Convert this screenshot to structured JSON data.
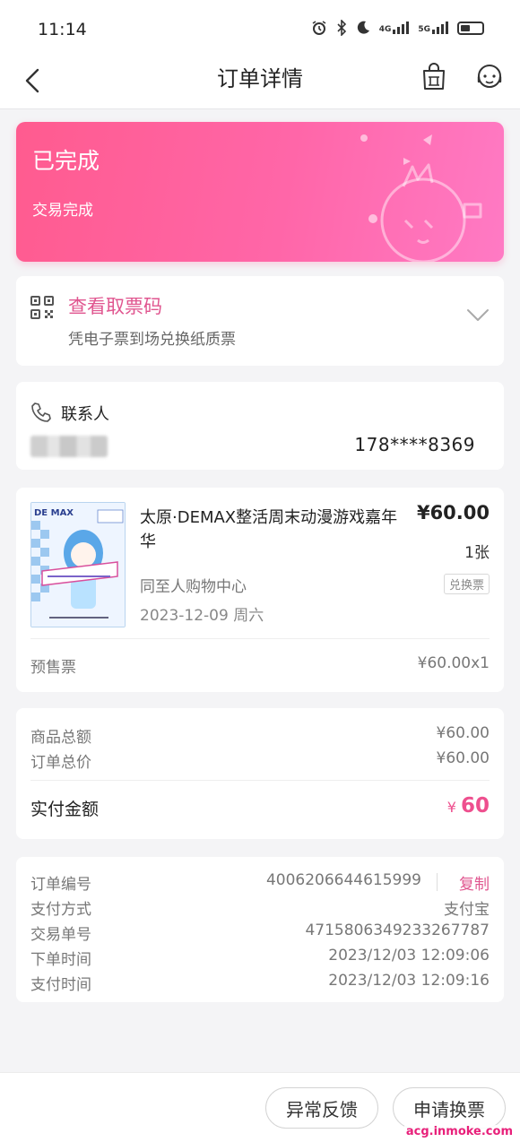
{
  "status_bar": {
    "time": "11:14",
    "icons": [
      "alarm-icon",
      "bluetooth-icon",
      "moon-icon",
      "4g-signal-icon",
      "5g-signal-icon",
      "battery-icon"
    ],
    "net1": "4G",
    "net2": "5G"
  },
  "header": {
    "title": "订单详情",
    "icons": [
      "back-icon",
      "shopping-bag-icon",
      "customer-service-icon"
    ]
  },
  "order_status": {
    "title": "已完成",
    "subtitle": "交易完成",
    "accent": "#ff5b8f"
  },
  "ticket_code": {
    "title": "查看取票码",
    "subtitle": "凭电子票到场兑换纸质票"
  },
  "contact": {
    "label": "联系人",
    "phone": "178****8369"
  },
  "product": {
    "title": "太原·DEMAX整活周末动漫游戏嘉年华",
    "price": "¥60.00",
    "quantity": "1张",
    "venue": "同至人购物中心",
    "tag": "兑换票",
    "date": "2023-12-09 周六",
    "ticket_type": "预售票",
    "ticket_price": "¥60.00x1",
    "poster_text": "DE MAX"
  },
  "amounts": {
    "goods_total_label": "商品总额",
    "goods_total_value": "¥60.00",
    "order_total_label": "订单总价",
    "order_total_value": "¥60.00",
    "paid_label": "实付金额",
    "paid_currency": "¥",
    "paid_value": "60",
    "paid_color": "#ee4f8e"
  },
  "order_info": {
    "order_no_label": "订单编号",
    "order_no_value": "4006206644615999",
    "copy_label": "复制",
    "pay_method_label": "支付方式",
    "pay_method_value": "支付宝",
    "trade_no_label": "交易单号",
    "trade_no_value": "4715806349233267787",
    "order_time_label": "下单时间",
    "order_time_value": "2023/12/03 12:09:06",
    "pay_time_label": "支付时间",
    "pay_time_value": "2023/12/03 12:09:16"
  },
  "actions": {
    "feedback": "异常反馈",
    "exchange": "申请换票"
  },
  "watermark": "acg.inmoke.com"
}
